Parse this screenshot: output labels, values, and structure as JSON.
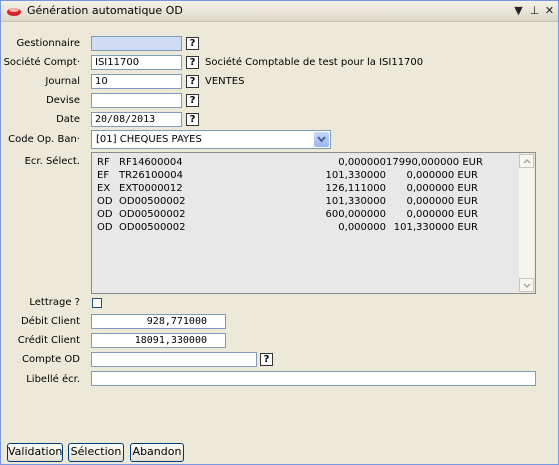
{
  "window": {
    "title": "Génération automatique OD",
    "controls": [
      "▼",
      "⊥",
      "✕"
    ]
  },
  "form": {
    "gestionnaire": {
      "label": "Gestionnaire",
      "value": ""
    },
    "societe": {
      "label": "Société Compt·",
      "value": "ISI11700",
      "description": "Société Comptable de test pour la ISI11700"
    },
    "journal": {
      "label": "Journal",
      "value": "10",
      "description": "VENTES"
    },
    "devise": {
      "label": "Devise",
      "value": ""
    },
    "date": {
      "label": "Date",
      "value": "20/08/2013"
    },
    "code_op": {
      "label": "Code Op. Ban·",
      "value": "[01] CHEQUES PAYES"
    },
    "ecr_select": {
      "label": "Ecr. Sélect."
    },
    "lettrage": {
      "label": "Lettrage ?",
      "checked": false
    },
    "debit_client": {
      "label": "Débit Client",
      "value": "928,771000"
    },
    "credit_client": {
      "label": "Crédit Client",
      "value": "18091,330000"
    },
    "compte_od": {
      "label": "Compte OD",
      "value": ""
    },
    "libelle": {
      "label": "Libellé écr.",
      "value": ""
    }
  },
  "entries": [
    {
      "journal": "RF",
      "ref": "RF14600004",
      "debit": "0,000000",
      "credit": "17990,000000 EUR"
    },
    {
      "journal": "EF",
      "ref": "TR26100004",
      "debit": "101,330000",
      "credit": "0,000000 EUR"
    },
    {
      "journal": "EX",
      "ref": "EXT0000012",
      "debit": "126,111000",
      "credit": "0,000000 EUR"
    },
    {
      "journal": "OD",
      "ref": "OD00500002",
      "debit": "101,330000",
      "credit": "0,000000 EUR"
    },
    {
      "journal": "OD",
      "ref": "OD00500002",
      "debit": "600,000000",
      "credit": "0,000000 EUR"
    },
    {
      "journal": "OD",
      "ref": "OD00500002",
      "debit": "0,000000",
      "credit": "101,330000 EUR"
    }
  ],
  "help_glyph": "?",
  "buttons": {
    "validation": "Validation",
    "selection": "Sélection",
    "abandon": "Abandon"
  },
  "colors": {
    "accent": "#7a96df",
    "focus_field": "#cfdcf3",
    "window_bg": "#ece9d8",
    "list_bg": "#e8e8e8"
  }
}
